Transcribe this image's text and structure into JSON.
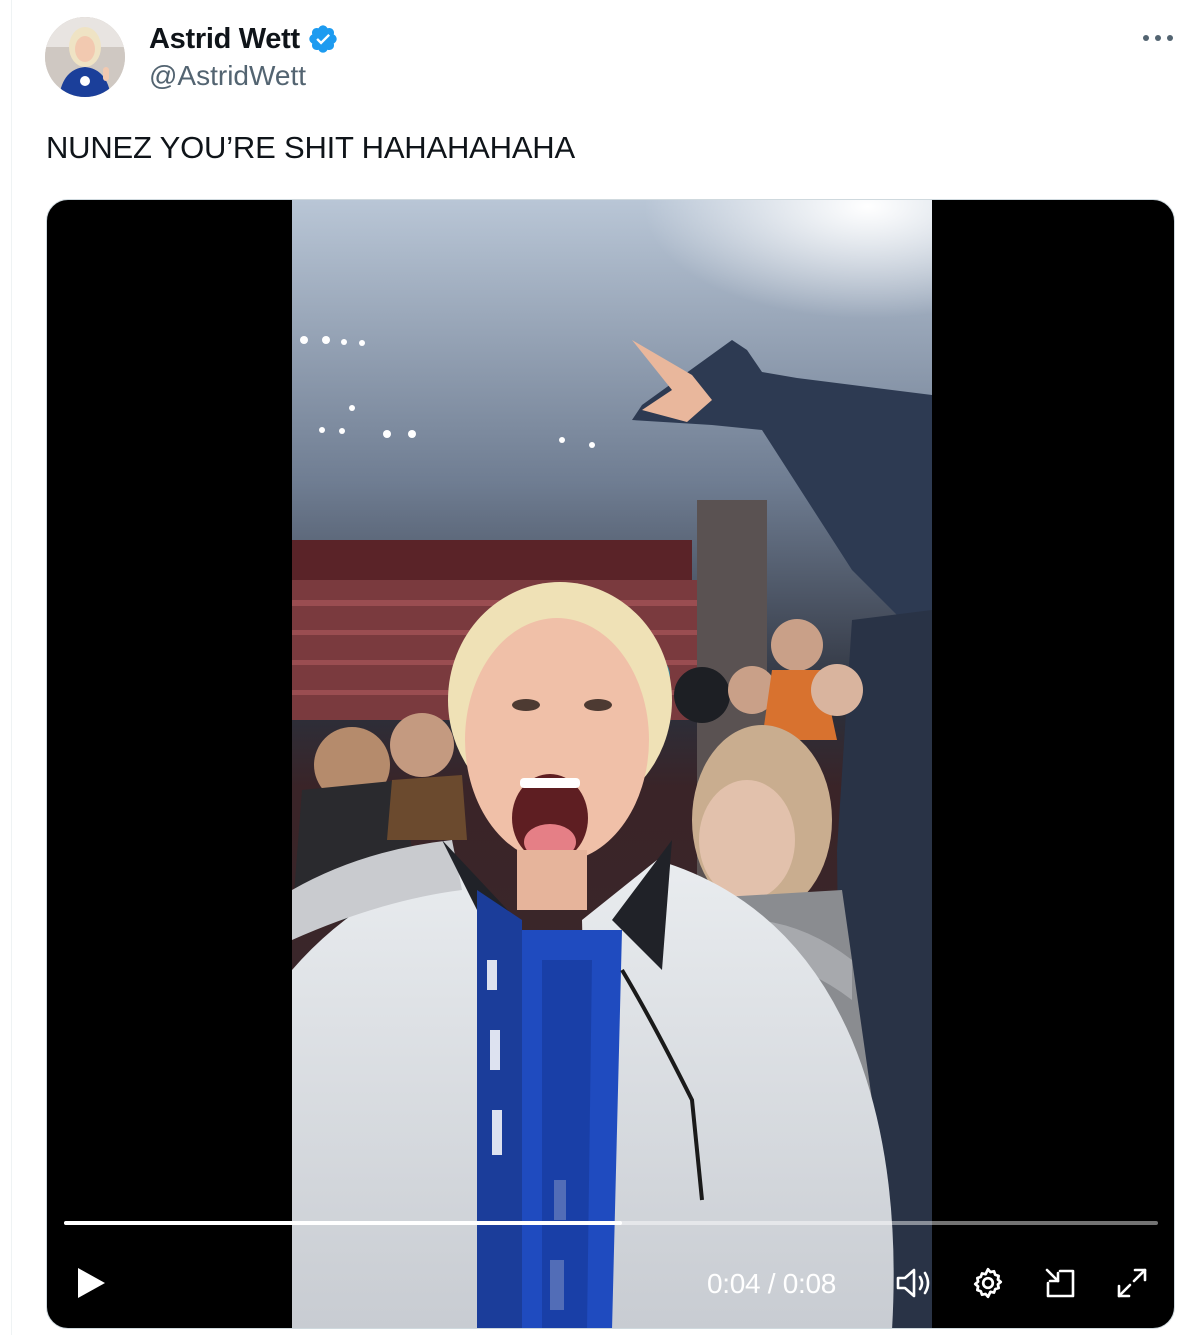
{
  "tweet": {
    "author": {
      "display_name": "Astrid Wett",
      "handle": "@AstridWett",
      "verified": true
    },
    "text": "NUNEZ YOU’RE SHIT HAHAHAHAHA"
  },
  "video": {
    "current_time": "0:04",
    "duration": "0:08",
    "time_display": "0:04 / 0:08",
    "progress": 0.51
  },
  "icons": {
    "verified": "verified-badge-icon",
    "more": "more-dots-icon",
    "play": "play-icon",
    "volume": "volume-icon",
    "settings": "gear-icon",
    "pip": "picture-in-picture-icon",
    "fullscreen": "fullscreen-icon"
  },
  "colors": {
    "verified_blue": "#1d9bf0",
    "text": "#0f1419",
    "secondary_text": "#536471",
    "video_bg": "#000000"
  }
}
